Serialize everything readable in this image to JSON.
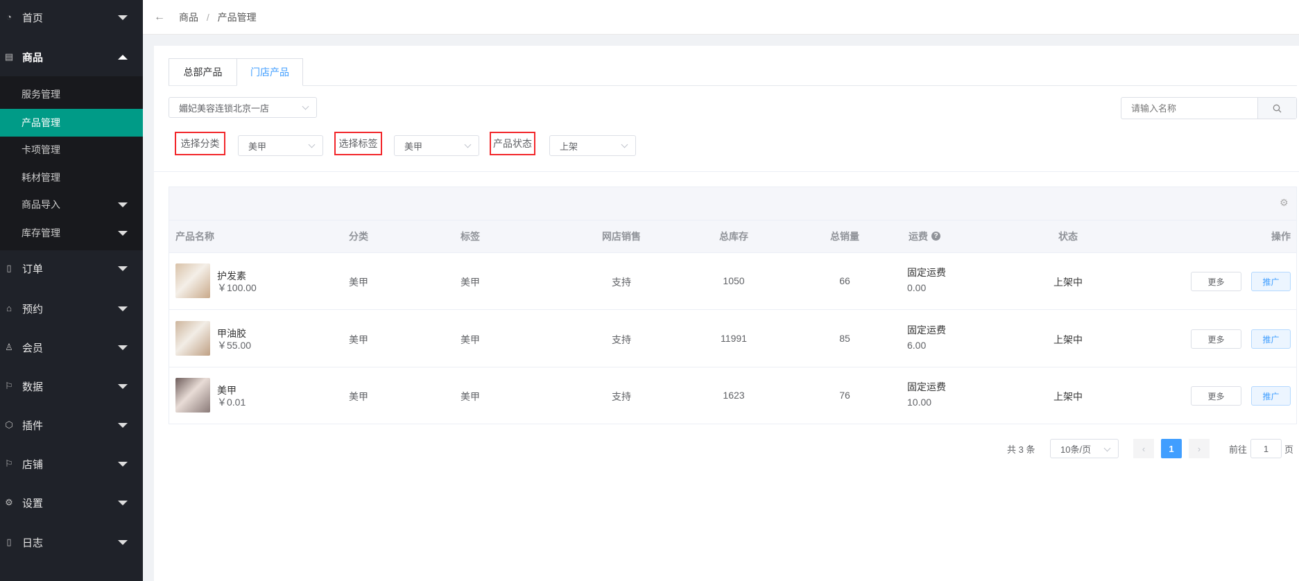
{
  "sidebar": {
    "items": [
      {
        "label": "首页",
        "icon": "dashboard-icon"
      },
      {
        "label": "商品",
        "icon": "document-icon",
        "expanded": true,
        "children": [
          "服务管理",
          "产品管理",
          "卡项管理",
          "耗材管理",
          "商品导入",
          "库存管理"
        ]
      },
      {
        "label": "订单",
        "icon": "clipboard-icon"
      },
      {
        "label": "预约",
        "icon": "home-icon"
      },
      {
        "label": "会员",
        "icon": "user-icon"
      },
      {
        "label": "数据",
        "icon": "flag-icon"
      },
      {
        "label": "插件",
        "icon": "cube-icon"
      },
      {
        "label": "店铺",
        "icon": "flag-icon"
      },
      {
        "label": "设置",
        "icon": "gear-icon"
      },
      {
        "label": "日志",
        "icon": "clipboard-icon"
      }
    ],
    "active_child": "产品管理"
  },
  "breadcrumb": [
    "商品",
    "产品管理"
  ],
  "tabs": [
    {
      "label": "总部产品",
      "active": false
    },
    {
      "label": "门店产品",
      "active": true
    }
  ],
  "store_select": "媚妃美容连锁北京一店",
  "search": {
    "placeholder": "请输入名称"
  },
  "filters": [
    {
      "label": "选择分类",
      "value": "美甲"
    },
    {
      "label": "选择标签",
      "value": "美甲"
    },
    {
      "label": "产品状态",
      "value": "上架"
    }
  ],
  "table": {
    "columns": [
      "产品名称",
      "分类",
      "标签",
      "网店销售",
      "总库存",
      "总销量",
      "运费",
      "状态",
      "操作"
    ],
    "rows": [
      {
        "name": "护发素",
        "price": "￥100.00",
        "category": "美甲",
        "tag": "美甲",
        "online": "支持",
        "stock": "1050",
        "sales": "66",
        "freight_type": "固定运费",
        "freight": "0.00",
        "status": "上架中"
      },
      {
        "name": "甲油胶",
        "price": "￥55.00",
        "category": "美甲",
        "tag": "美甲",
        "online": "支持",
        "stock": "11991",
        "sales": "85",
        "freight_type": "固定运费",
        "freight": "6.00",
        "status": "上架中"
      },
      {
        "name": "美甲",
        "price": "￥0.01",
        "category": "美甲",
        "tag": "美甲",
        "online": "支持",
        "stock": "1623",
        "sales": "76",
        "freight_type": "固定运费",
        "freight": "10.00",
        "status": "上架中"
      }
    ],
    "more_label": "更多",
    "promote_label": "推广"
  },
  "pagination": {
    "total": "共 3 条",
    "page_size": "10条/页",
    "current": "1",
    "goto_label": "前往",
    "goto_value": "1",
    "page_suffix": "页"
  },
  "colors": {
    "accent": "#009b87",
    "primary": "#409eff",
    "sidebar": "#1f2229"
  }
}
